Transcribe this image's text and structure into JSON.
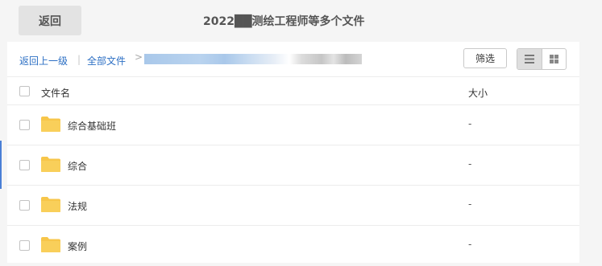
{
  "header": {
    "back_label": "返回",
    "title": "2022██测绘工程师等多个文件"
  },
  "toolbar": {
    "up_label": "返回上一级",
    "separator": "|",
    "all_files_label": "全部文件",
    "crumb_arrow": ">",
    "filter_label": "筛选"
  },
  "columns": {
    "name": "文件名",
    "size": "大小"
  },
  "files": [
    {
      "name": "综合基础班",
      "size": "-"
    },
    {
      "name": "综合",
      "size": "-"
    },
    {
      "name": "法规",
      "size": "-"
    },
    {
      "name": "案例",
      "size": "-"
    }
  ],
  "colors": {
    "accent": "#2c6fc4",
    "folder": "#f7c64a"
  },
  "icons": [
    "list-view-icon",
    "grid-view-icon",
    "folder-icon",
    "chevron-right-icon"
  ]
}
